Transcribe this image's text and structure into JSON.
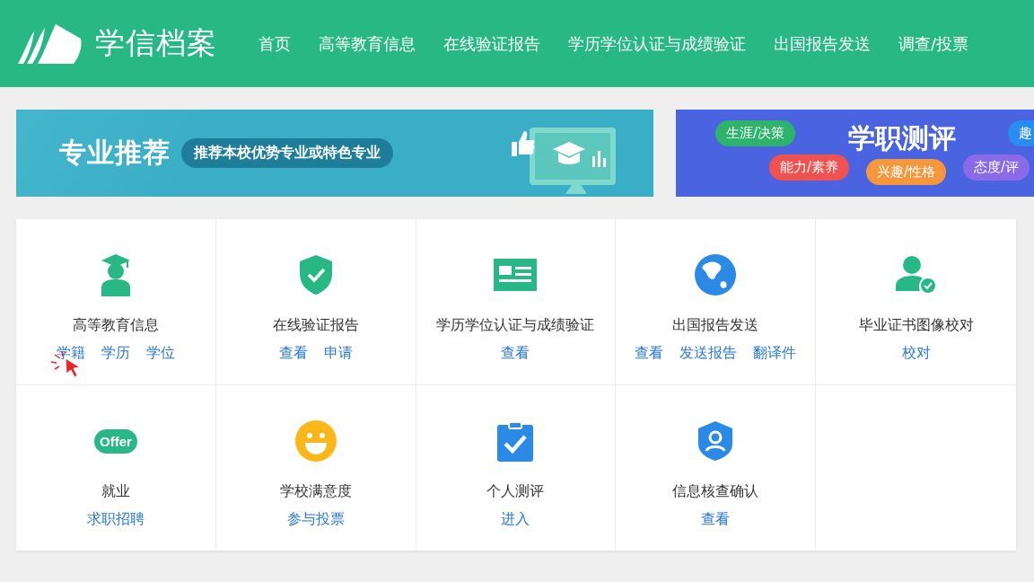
{
  "header": {
    "logo_text": "学信档案",
    "nav": [
      {
        "label": "首页"
      },
      {
        "label": "高等教育信息"
      },
      {
        "label": "在线验证报告"
      },
      {
        "label": "学历学位认证与成绩验证"
      },
      {
        "label": "出国报告发送"
      },
      {
        "label": "调查/投票"
      }
    ]
  },
  "banners": [
    {
      "kind": "promo",
      "title": "专业推荐",
      "tagline": "推荐本校优势专业或特色专业"
    },
    {
      "kind": "assessment",
      "title": "学职测评",
      "tags": [
        {
          "label": "生涯/决策",
          "color": "#2db36b"
        },
        {
          "label": "趣",
          "color": "#2a8cf0"
        },
        {
          "label": "能力/素养",
          "color": "#f0524f"
        },
        {
          "label": "兴趣/性格",
          "color": "#f5973a"
        },
        {
          "label": "态度/评",
          "color": "#8a6ae8"
        }
      ]
    }
  ],
  "services": [
    {
      "kind": "graduate",
      "title": "高等教育信息",
      "links": [
        {
          "label": "学籍",
          "hovered": true
        },
        {
          "label": "学历",
          "hovered": false
        },
        {
          "label": "学位",
          "hovered": false
        }
      ]
    },
    {
      "kind": "shield-check",
      "title": "在线验证报告",
      "links": [
        {
          "label": "查看",
          "hovered": false
        },
        {
          "label": "申请",
          "hovered": false
        }
      ]
    },
    {
      "kind": "card",
      "title": "学历学位认证与成绩验证",
      "links": [
        {
          "label": "查看",
          "hovered": false
        }
      ]
    },
    {
      "kind": "globe",
      "title": "出国报告发送",
      "links": [
        {
          "label": "查看",
          "hovered": false
        },
        {
          "label": "发送报告",
          "hovered": false
        },
        {
          "label": "翻译件",
          "hovered": false
        }
      ]
    },
    {
      "kind": "person-check",
      "title": "毕业证书图像校对",
      "links": [
        {
          "label": "校对",
          "hovered": false
        }
      ]
    },
    {
      "kind": "offer",
      "icon_text": "Offer",
      "title": "就业",
      "links": [
        {
          "label": "求职招聘",
          "hovered": false
        }
      ]
    },
    {
      "kind": "smiley",
      "title": "学校满意度",
      "links": [
        {
          "label": "参与投票",
          "hovered": false
        }
      ]
    },
    {
      "kind": "clipboard",
      "title": "个人测评",
      "links": [
        {
          "label": "进入",
          "hovered": false
        }
      ]
    },
    {
      "kind": "shield-person",
      "title": "信息核查确认",
      "links": [
        {
          "label": "查看",
          "hovered": false
        }
      ]
    }
  ]
}
